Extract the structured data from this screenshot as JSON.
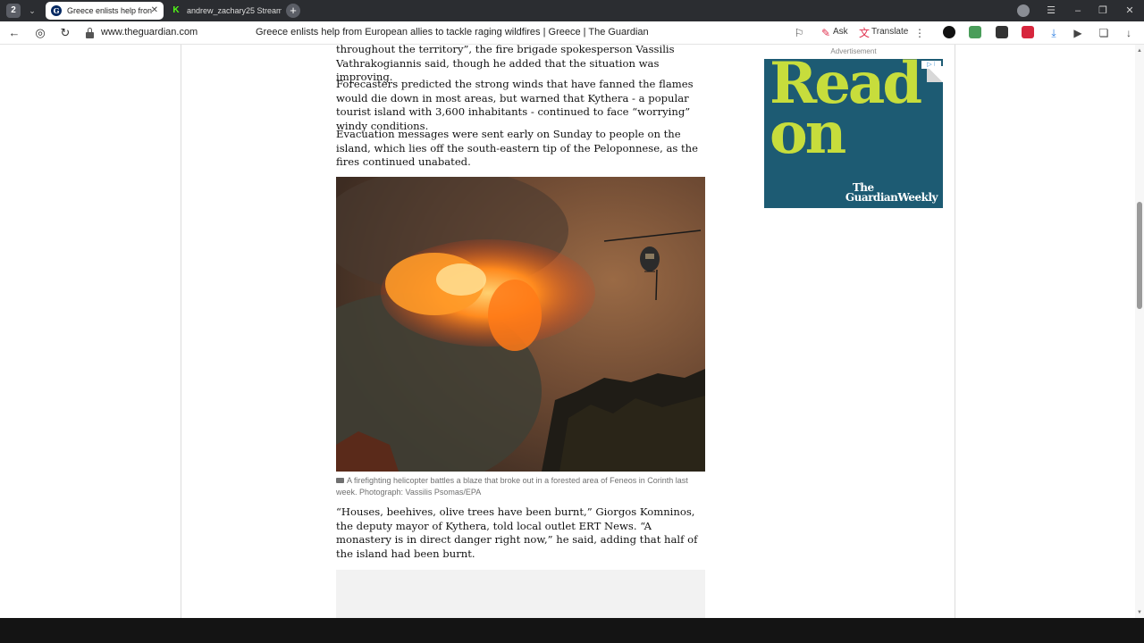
{
  "browser": {
    "tab_count": "2",
    "tabs": [
      {
        "title": "Greece enlists help fron",
        "icon": "guardian-favicon"
      },
      {
        "title": "andrew_zachary25 Stream",
        "icon": "kick-favicon"
      }
    ],
    "url": "www.theguardian.com",
    "page_title": "Greece enlists help from European allies to tackle raging wildfires | Greece | The Guardian",
    "ask_label": "Ask",
    "translate_label": "Translate"
  },
  "article": {
    "para1": "throughout the territory”, the fire brigade spokesperson Vassilis Vathrakogiannis said, though he added that the situation was improving.",
    "para2": "Forecasters predicted the strong winds that have fanned the flames would die down in most areas, but warned that Kythera - a popular tourist island with 3,600 inhabitants - continued to face “worrying” windy conditions.",
    "para3": "Evacuation messages were sent early on Sunday to people on the island, which lies off the south-eastern tip of the Peloponnese, as the fires continued unabated.",
    "caption": "A firefighting helicopter battles a blaze that broke out in a forested area of Feneos in Corinth last week. Photograph: Vassilis Psomas/EPA",
    "para4": "“Houses, beehives, olive trees have been burnt,” Giorgos Komninos, the deputy mayor of Kythera, told local outlet ERT News. “A monastery is in direct danger right now,” he said, adding that half of the island had been burnt."
  },
  "ad": {
    "label": "Advertisement",
    "headline_line1": "Read",
    "headline_line2": "on",
    "brand_line1": "The",
    "brand_line2": "GuardianWeekly",
    "choice": "▷ ⁝"
  }
}
